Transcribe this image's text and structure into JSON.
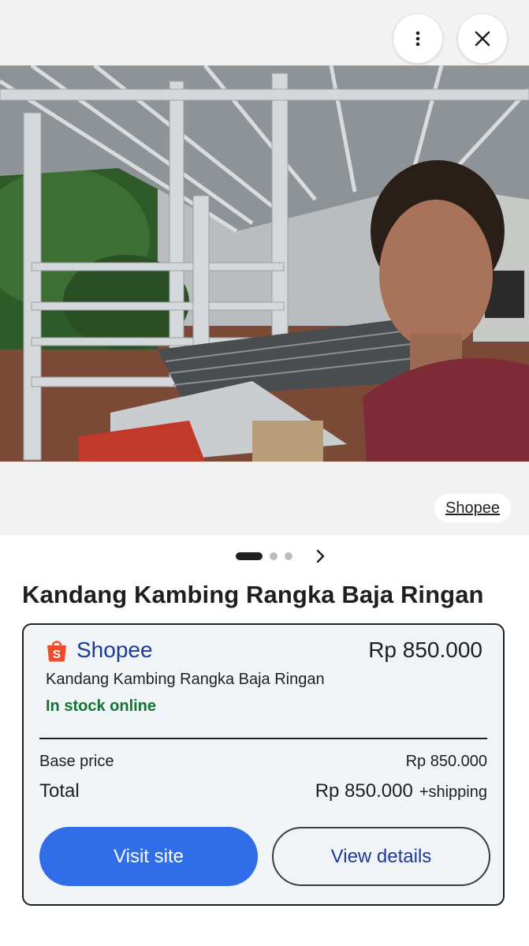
{
  "viewer": {
    "more_icon": "more-vert-icon",
    "close_icon": "close-icon",
    "source_label": "Shopee",
    "pager": {
      "total": 3,
      "current": 1,
      "next_icon": "chevron-right-icon"
    }
  },
  "product": {
    "title": "Kandang Kambing Rangka Baja Ringan"
  },
  "offer": {
    "merchant_icon": "shopee-bag-icon",
    "merchant": "Shopee",
    "price": "Rp 850.000",
    "product_name": "Kandang Kambing Rangka Baja Ringan",
    "stock": "In stock online",
    "base_price_label": "Base price",
    "base_price_value": "Rp 850.000",
    "total_label": "Total",
    "total_value": "Rp 850.000",
    "shipping_note": "+shipping",
    "visit_label": "Visit site",
    "details_label": "View details"
  },
  "colors": {
    "accent_blue": "#2f6ee8",
    "link_blue": "#1a3a9c",
    "stock_green": "#137333",
    "shopee_orange": "#ee4d2d"
  }
}
